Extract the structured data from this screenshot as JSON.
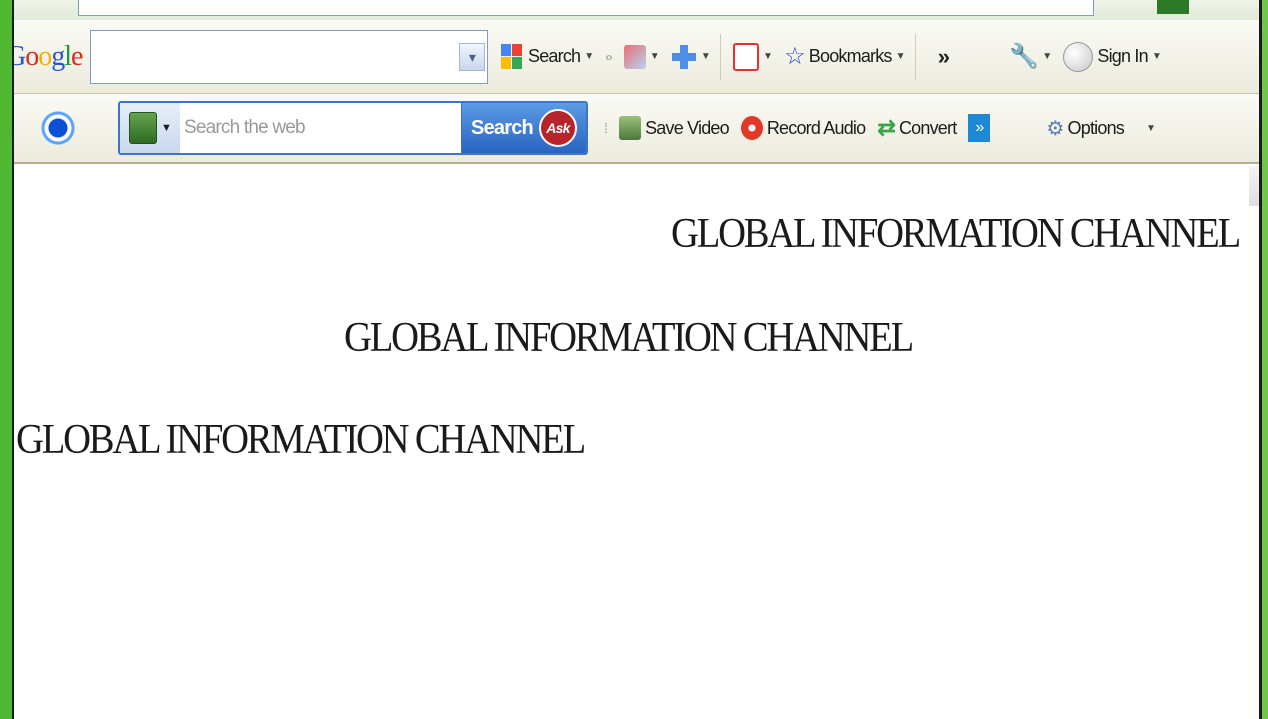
{
  "google_toolbar": {
    "logo": "Google",
    "search_value": "",
    "search_label": "Search",
    "bookmarks_label": "Bookmarks",
    "overflow": "»",
    "sign_in_label": "Sign In"
  },
  "ask_toolbar": {
    "search_placeholder": "Search the web",
    "search_button": "Search",
    "ask_logo": "Ask",
    "save_video": "Save Video",
    "record_audio": "Record Audio",
    "convert": "Convert",
    "more": "»",
    "options": "Options"
  },
  "page": {
    "heading_right": "GLOBAL INFORMATION CHANNEL",
    "heading_center": "GLOBAL INFORMATION CHANNEL",
    "heading_left": "GLOBAL INFORMATION CHANNEL"
  },
  "colors": {
    "desktop_green": "#6cc84a",
    "ask_blue": "#2964c0",
    "ask_red": "#b8242b"
  },
  "icons": [
    "dropdown-arrow-icon",
    "google-search-icon",
    "bookmark-star-icon",
    "wrench-icon",
    "ask-signal-icon",
    "globe-icon",
    "save-video-icon",
    "record-audio-icon",
    "convert-icon",
    "options-gear-icon"
  ]
}
